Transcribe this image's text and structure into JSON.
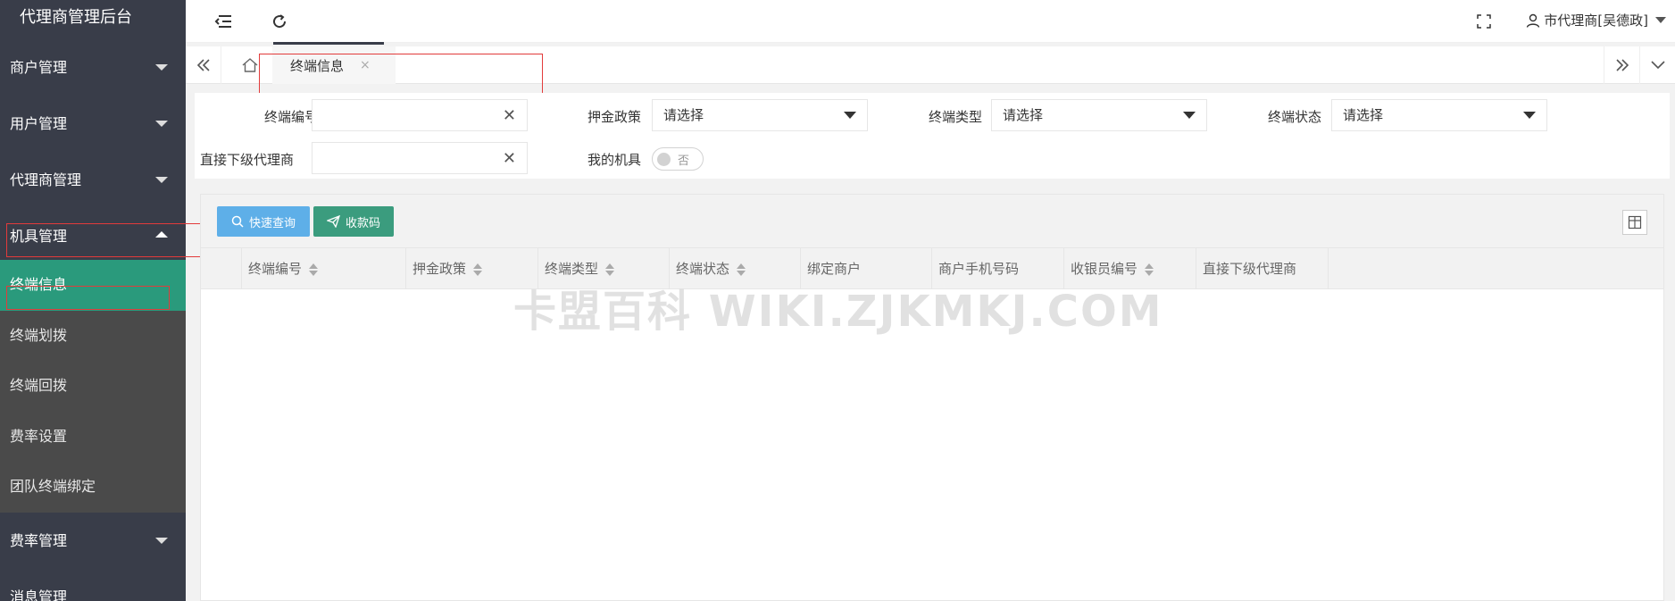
{
  "app": {
    "title": "代理商管理后台"
  },
  "sidebar": {
    "items": [
      {
        "label": "商户管理"
      },
      {
        "label": "用户管理"
      },
      {
        "label": "代理商管理"
      },
      {
        "label": "机具管理"
      }
    ],
    "sub_items": [
      {
        "label": "终端信息"
      },
      {
        "label": "终端划拨"
      },
      {
        "label": "终端回拨"
      },
      {
        "label": "费率设置"
      },
      {
        "label": "团队终端绑定"
      }
    ],
    "after_items": [
      {
        "label": "费率管理"
      },
      {
        "label": "消息管理"
      }
    ]
  },
  "header": {
    "user": "市代理商[吴德政]"
  },
  "tabs": [
    {
      "label": "终端信息",
      "close": "×"
    }
  ],
  "filter": {
    "terminal_no_label": "终端编号",
    "deposit_label": "押金政策",
    "deposit_value": "请选择",
    "type_label": "终端类型",
    "type_value": "请选择",
    "status_label": "终端状态",
    "status_value": "请选择",
    "agent_label": "直接下级代理商",
    "mine_label": "我的机具",
    "mine_value": "否"
  },
  "toolbar": {
    "quick_query": "快速查询",
    "qr_code": "收款码"
  },
  "table": {
    "columns": [
      {
        "label": "终端编号",
        "sortable": true
      },
      {
        "label": "押金政策",
        "sortable": true
      },
      {
        "label": "终端类型",
        "sortable": true
      },
      {
        "label": "终端状态",
        "sortable": true
      },
      {
        "label": "绑定商户",
        "sortable": false
      },
      {
        "label": "商户手机号码",
        "sortable": false
      },
      {
        "label": "收银员编号",
        "sortable": true
      },
      {
        "label": "直接下级代理商",
        "sortable": false
      }
    ]
  },
  "watermark": "卡盟百科  WIKI.ZJKMKJ.COM",
  "colors": {
    "sidebar": "#393d49",
    "active": "#2a9a7c",
    "primary": "#5eafe8",
    "success": "#3b9c7e",
    "highlight": "#e23b3b"
  }
}
